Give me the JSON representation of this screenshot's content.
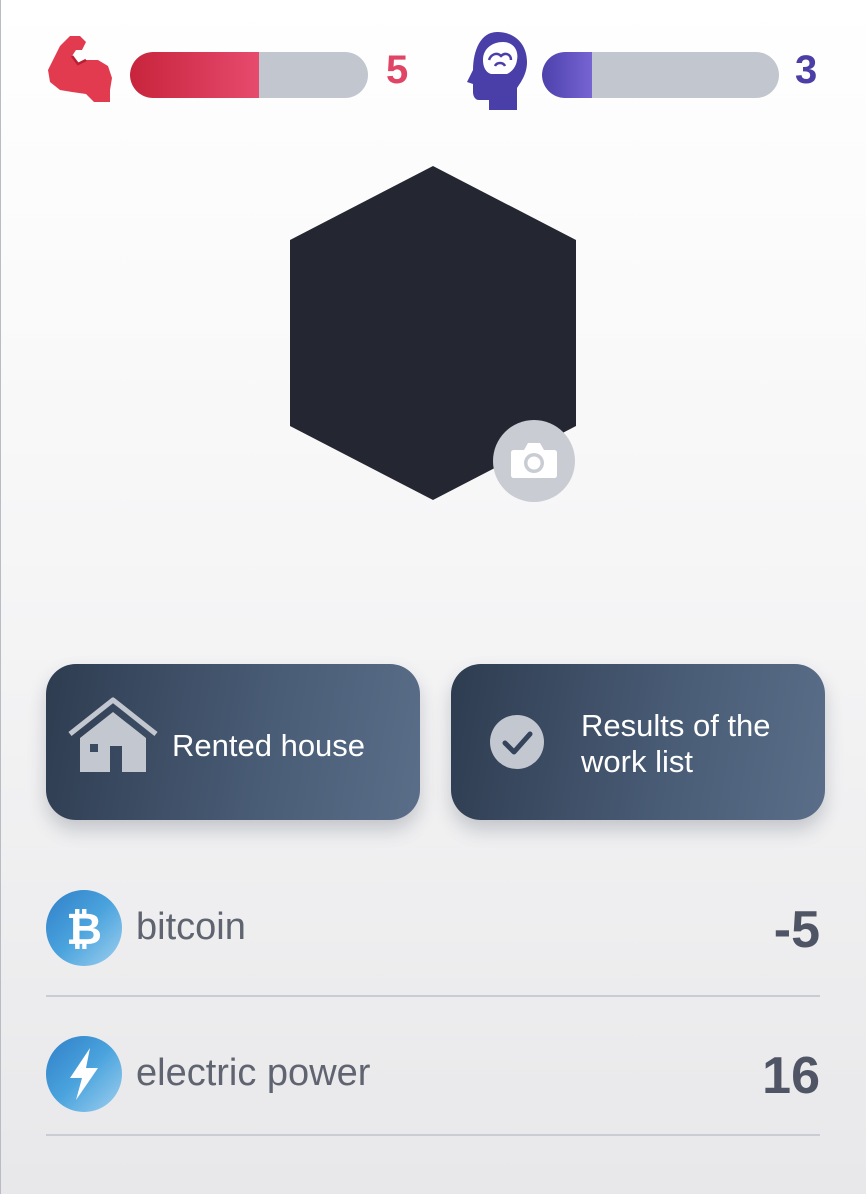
{
  "stats": {
    "strength": {
      "value": "5",
      "level_fraction": 0.54,
      "icon": "flexed-arm-icon",
      "color": "#e04566"
    },
    "intellect": {
      "value": "3",
      "level_fraction": 0.21,
      "icon": "head-brain-icon",
      "color": "#4b3ea6"
    }
  },
  "avatar": {
    "shape": "hexagon",
    "color": "#242731",
    "camera_icon": "camera-icon"
  },
  "actions": {
    "rented_house": {
      "label": "Rented house",
      "icon": "house-icon"
    },
    "results": {
      "label": "Results of the work list",
      "icon": "checkmark-circle-icon"
    }
  },
  "resources": [
    {
      "name": "bitcoin",
      "value": "-5",
      "icon": "bitcoin-icon"
    },
    {
      "name": "electric power",
      "value": "16",
      "icon": "lightning-icon"
    }
  ]
}
